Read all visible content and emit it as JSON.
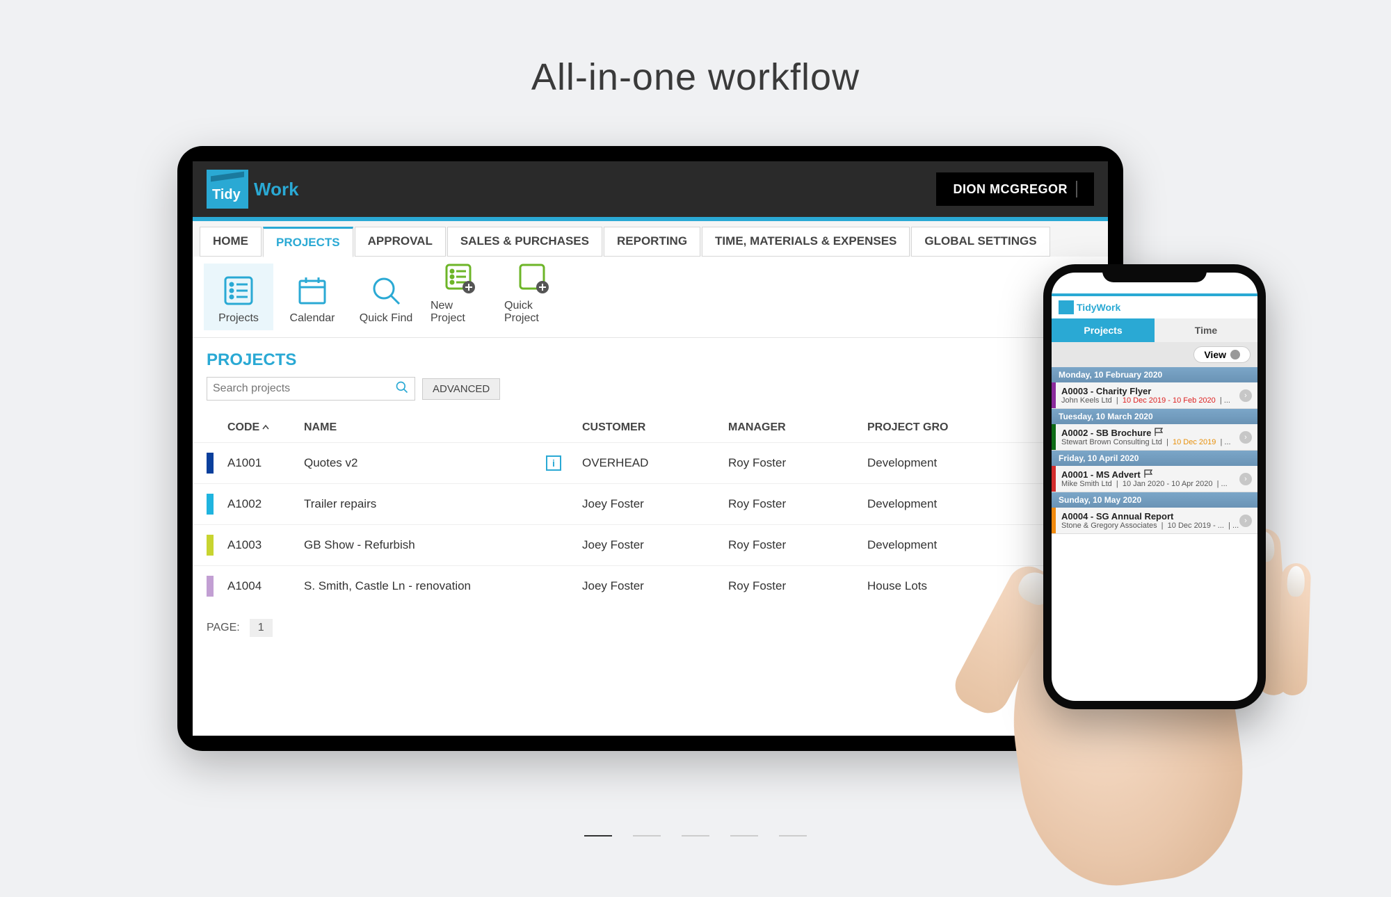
{
  "headline": "All-in-one workflow",
  "logo": {
    "mark": "Tidy",
    "work": "Work"
  },
  "user": "DION MCGREGOR",
  "tabs": [
    "HOME",
    "PROJECTS",
    "APPROVAL",
    "SALES & PURCHASES",
    "REPORTING",
    "TIME, MATERIALS & EXPENSES",
    "GLOBAL SETTINGS"
  ],
  "active_tab": 1,
  "toolbar": [
    {
      "label": "Projects",
      "icon": "list",
      "active": true
    },
    {
      "label": "Calendar",
      "icon": "calendar",
      "active": false
    },
    {
      "label": "Quick Find",
      "icon": "search",
      "active": false
    },
    {
      "label": "New Project",
      "icon": "new-list",
      "active": false
    },
    {
      "label": "Quick Project",
      "icon": "new-box",
      "active": false
    }
  ],
  "section_title": "PROJECTS",
  "search": {
    "placeholder": "Search projects",
    "advanced": "ADVANCED"
  },
  "columns": {
    "code": "CODE",
    "name": "NAME",
    "customer": "CUSTOMER",
    "manager": "MANAGER",
    "group": "PROJECT GRO"
  },
  "rows": [
    {
      "color": "#0a3f9c",
      "code": "A1001",
      "name": "Quotes v2",
      "customer": "OVERHEAD",
      "manager": "Roy Foster",
      "group": "Development",
      "info": true
    },
    {
      "color": "#1fb4df",
      "code": "A1002",
      "name": "Trailer repairs",
      "customer": "Joey Foster",
      "manager": "Roy Foster",
      "group": "Development",
      "info": false
    },
    {
      "color": "#c8d430",
      "code": "A1003",
      "name": "GB Show - Refurbish",
      "customer": "Joey Foster",
      "manager": "Roy Foster",
      "group": "Development",
      "info": false
    },
    {
      "color": "#c29fd3",
      "code": "A1004",
      "name": "S. Smith, Castle Ln - renovation",
      "customer": "Joey Foster",
      "manager": "Roy Foster",
      "group": "House Lots",
      "info": false
    }
  ],
  "pager": {
    "label": "PAGE:",
    "current": "1"
  },
  "mobile": {
    "tabs": {
      "projects": "Projects",
      "time": "Time"
    },
    "view": "View",
    "list": [
      {
        "header": "Monday, 10 February 2020",
        "bar": "#8a2a9c",
        "title": "A0003 - Charity Flyer",
        "flag": false,
        "company": "John Keels Ltd",
        "dates": "10 Dec 2019 - 10 Feb 2020",
        "dates_class": "red"
      },
      {
        "header": "Tuesday, 10 March 2020",
        "bar": "#0f6b17",
        "title": "A0002 - SB Brochure",
        "flag": true,
        "company": "Stewart Brown Consulting Ltd",
        "dates": "10 Dec 2019",
        "dates_class": "orange"
      },
      {
        "header": "Friday, 10 April 2020",
        "bar": "#d22d2d",
        "title": "A0001 - MS Advert",
        "flag": true,
        "company": "Mike Smith Ltd",
        "dates": "10 Jan 2020 - 10 Apr 2020",
        "dates_class": ""
      },
      {
        "header": "Sunday, 10 May 2020",
        "bar": "#f08a0f",
        "title": "A0004 - SG Annual Report",
        "flag": false,
        "company": "Stone & Gregory Associates",
        "dates": "10 Dec 2019 - ...",
        "dates_class": ""
      }
    ]
  }
}
